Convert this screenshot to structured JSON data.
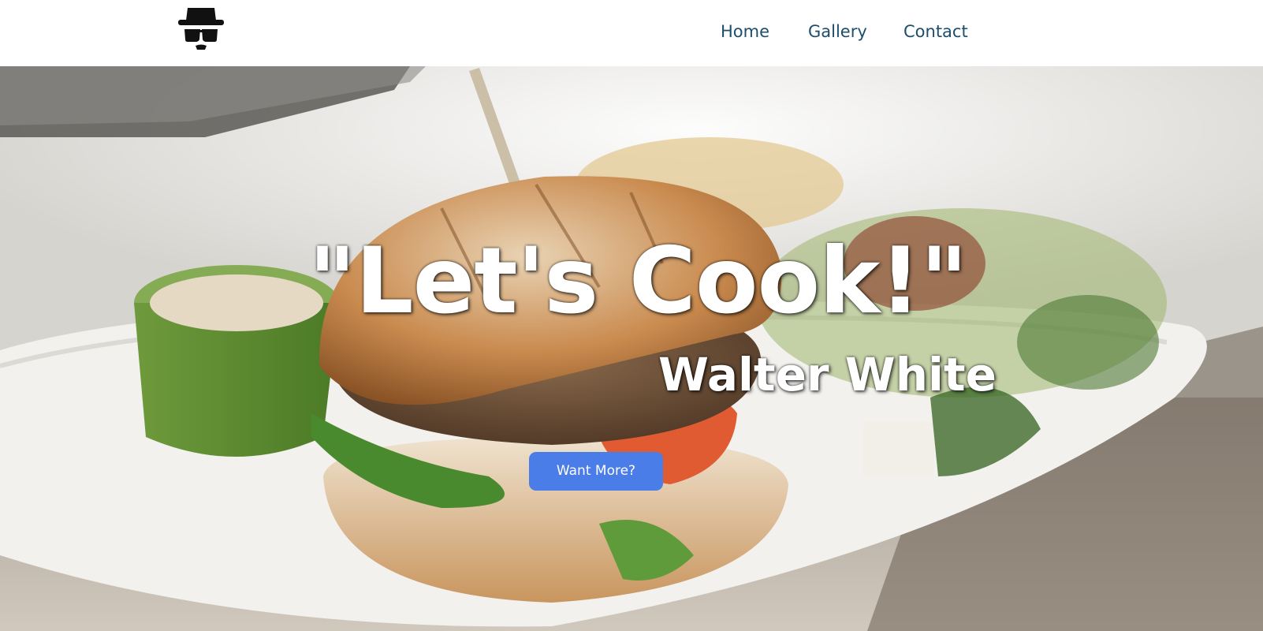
{
  "header": {
    "logo_icon": "heisenberg-hat-glasses-icon",
    "nav": [
      {
        "label": "Home"
      },
      {
        "label": "Gallery"
      },
      {
        "label": "Contact"
      }
    ]
  },
  "hero": {
    "title": "\"Let's Cook!\"",
    "subtitle": "Walter White",
    "cta_label": "Want More?",
    "background_image": "burger-and-salad-on-plate-photo"
  },
  "colors": {
    "nav_text": "#1d4e6e",
    "cta_background": "#4a7de8",
    "hero_text": "#ffffff"
  }
}
